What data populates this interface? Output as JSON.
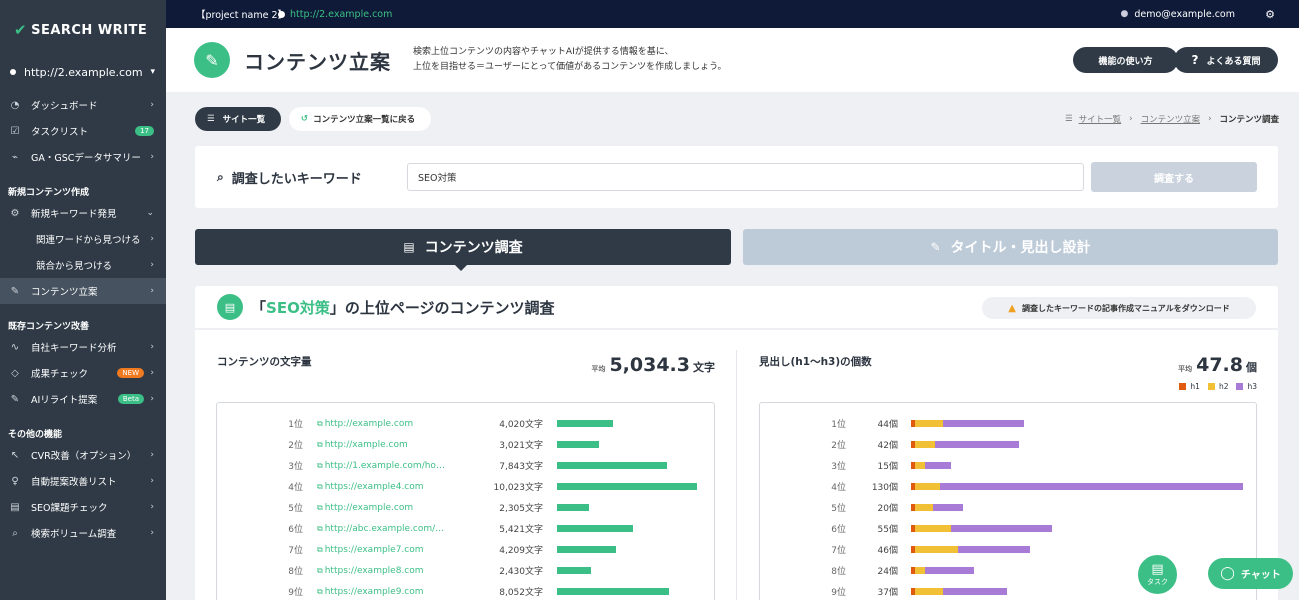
{
  "app": {
    "logo": "SEARCH WRITE"
  },
  "topbar": {
    "project": "【project name 2】",
    "url": "http://2.example.com",
    "user": "demo@example.com"
  },
  "sidebar": {
    "site": "http://2.example.com",
    "items_top": [
      {
        "label": "ダッシュボード",
        "icon": "gauge-icon"
      },
      {
        "label": "タスクリスト",
        "icon": "checkbox-icon",
        "badge": "17"
      },
      {
        "label": "GA・GSCデータサマリー",
        "icon": "chart-icon"
      }
    ],
    "section_new": "新規コンテンツ作成",
    "items_new": [
      {
        "label": "新規キーワード発見"
      },
      {
        "label": "関連ワードから見つける"
      },
      {
        "label": "競合から見つける"
      },
      {
        "label": "コンテンツ立案"
      }
    ],
    "section_existing": "既存コンテンツ改善",
    "items_existing": [
      {
        "label": "自社キーワード分析"
      },
      {
        "label": "成果チェック",
        "badge": "NEW"
      },
      {
        "label": "AIリライト提案",
        "badge": "Beta"
      }
    ],
    "section_other": "その他の機能",
    "items_other": [
      {
        "label": "CVR改善（オプション）"
      },
      {
        "label": "自動提案改善リスト"
      },
      {
        "label": "SEO課題チェック"
      },
      {
        "label": "検索ボリューム調査"
      }
    ]
  },
  "header": {
    "title": "コンテンツ立案",
    "desc1": "検索上位コンテンツの内容やチャットAIが提供する情報を基に、",
    "desc2": "上位を目指せる＝ユーザーにとって価値があるコンテンツを作成しましょう。",
    "howto": "機能の使い方",
    "faq": "よくある質問"
  },
  "nav": {
    "site_list": "サイト一覧",
    "back": "コンテンツ立案一覧に戻る",
    "crumb1": "サイト一覧",
    "crumb2": "コンテンツ立案",
    "crumb3": "コンテンツ調査"
  },
  "search": {
    "label": "調査したいキーワード",
    "value": "SEO対策",
    "button": "調査する"
  },
  "tabs": {
    "content": "コンテンツ調査",
    "title": "タイトル・見出し設計"
  },
  "result": {
    "q_open": "「",
    "keyword": "SEO対策",
    "title_rest": "」の上位ページのコンテンツ調査",
    "download": "調査したキーワードの記事作成マニュアルをダウンロード"
  },
  "chars_panel": {
    "title": "コンテンツの文字量",
    "avg_label": "平均",
    "avg": "5,034.3",
    "unit": "文字",
    "max": 10023,
    "rows": [
      {
        "rank": "1位",
        "url": "http://example.com",
        "chars": "4,020文字",
        "value": 4020
      },
      {
        "rank": "2位",
        "url": "http://xample.com",
        "chars": "3,021文字",
        "value": 3021
      },
      {
        "rank": "3位",
        "url": "http://1.example.com/ho…",
        "chars": "7,843文字",
        "value": 7843
      },
      {
        "rank": "4位",
        "url": "https://example4.com",
        "chars": "10,023文字",
        "value": 10023
      },
      {
        "rank": "5位",
        "url": "http://example.com",
        "chars": "2,305文字",
        "value": 2305
      },
      {
        "rank": "6位",
        "url": "http://abc.example.com/…",
        "chars": "5,421文字",
        "value": 5421
      },
      {
        "rank": "7位",
        "url": "https://example7.com",
        "chars": "4,209文字",
        "value": 4209
      },
      {
        "rank": "8位",
        "url": "https://example8.com",
        "chars": "2,430文字",
        "value": 2430
      },
      {
        "rank": "9位",
        "url": "https://example9.com",
        "chars": "8,052文字",
        "value": 8052
      }
    ]
  },
  "heading_panel": {
    "title": "見出し(h1〜h3)の個数",
    "avg_label": "平均",
    "avg": "47.8",
    "unit": "個",
    "legend": [
      {
        "name": "h1",
        "color": "#e05a10"
      },
      {
        "name": "h2",
        "color": "#f2c034"
      },
      {
        "name": "h3",
        "color": "#a77bd6"
      }
    ],
    "max": 130,
    "rows": [
      {
        "rank": "1位",
        "count": "44個",
        "h1": 1,
        "h2": 11,
        "h3": 32
      },
      {
        "rank": "2位",
        "count": "42個",
        "h1": 1,
        "h2": 8,
        "h3": 33
      },
      {
        "rank": "3位",
        "count": "15個",
        "h1": 1,
        "h2": 4,
        "h3": 10
      },
      {
        "rank": "4位",
        "count": "130個",
        "h1": 1,
        "h2": 10,
        "h3": 119
      },
      {
        "rank": "5位",
        "count": "20個",
        "h1": 1,
        "h2": 7,
        "h3": 12
      },
      {
        "rank": "6位",
        "count": "55個",
        "h1": 1,
        "h2": 14,
        "h3": 40
      },
      {
        "rank": "7位",
        "count": "46個",
        "h1": 1,
        "h2": 17,
        "h3": 28
      },
      {
        "rank": "8位",
        "count": "24個",
        "h1": 1,
        "h2": 4,
        "h3": 19
      },
      {
        "rank": "9位",
        "count": "37個",
        "h1": 1,
        "h2": 11,
        "h3": 25
      }
    ]
  },
  "float": {
    "task": "タスク",
    "chat": "チャット"
  }
}
